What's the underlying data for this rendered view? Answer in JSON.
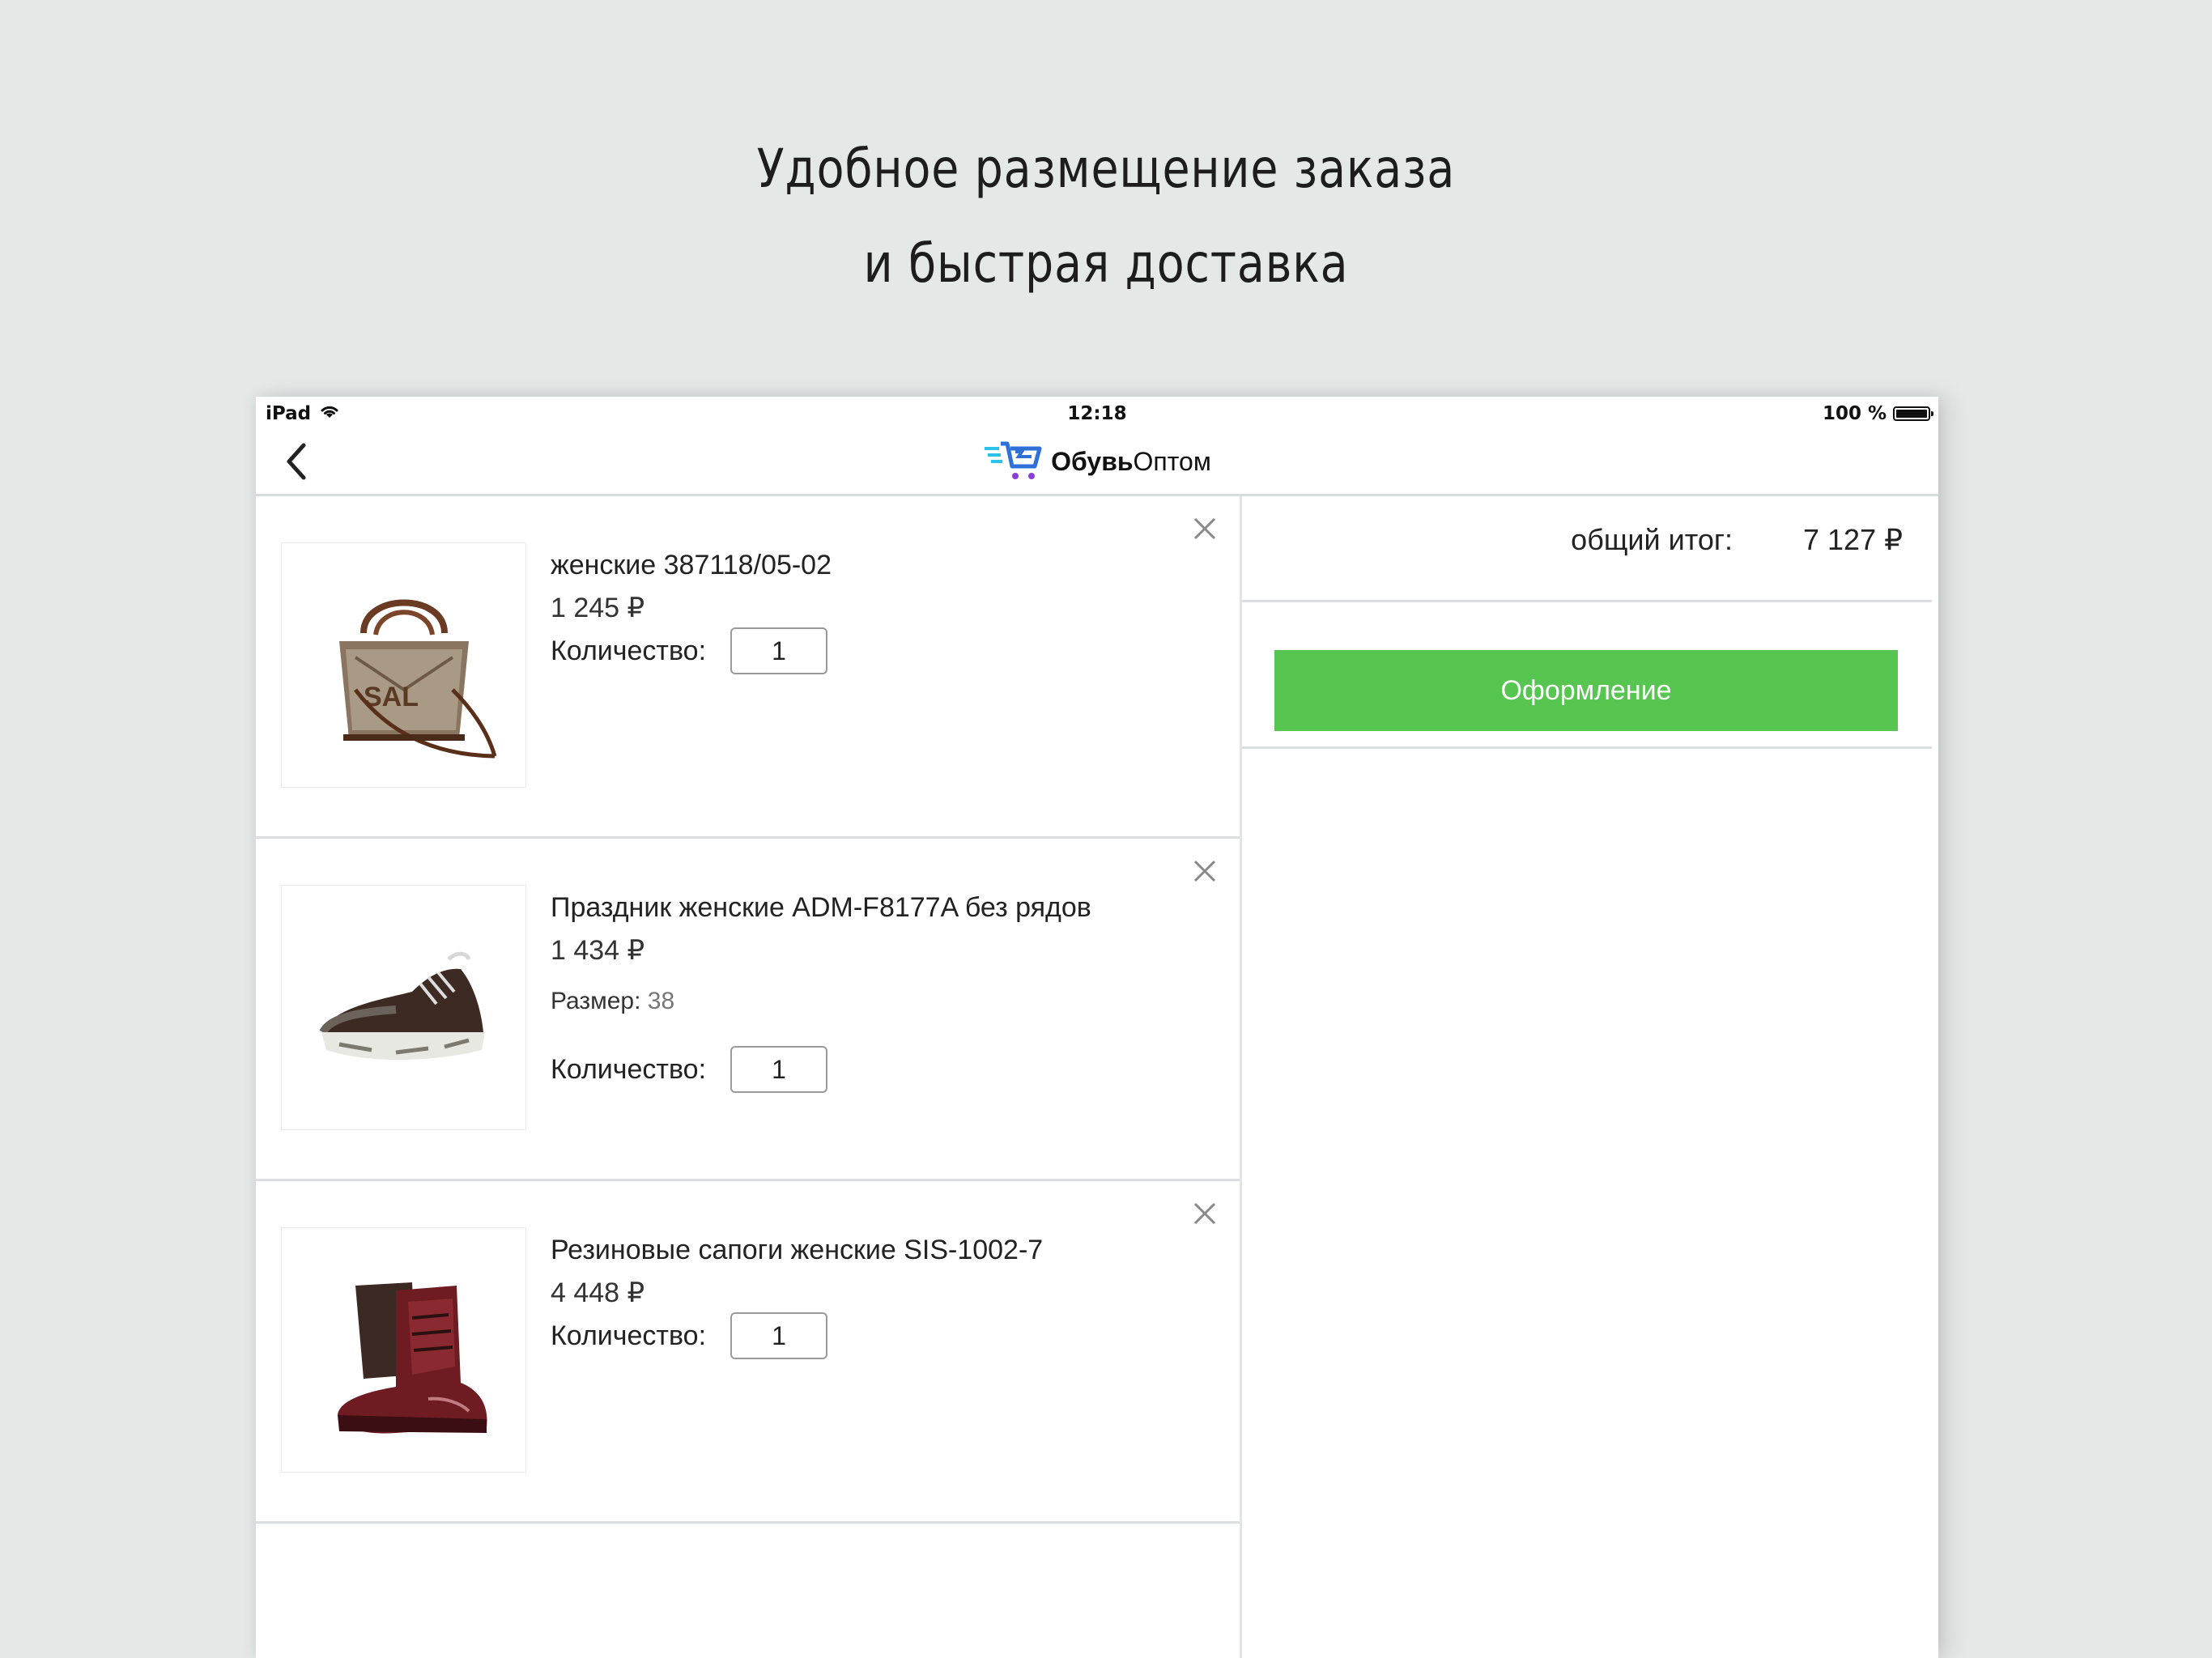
{
  "headline": {
    "line1": "Удобное размещение заказа",
    "line2": "и быстрая доставка"
  },
  "status_bar": {
    "device": "iPad",
    "time": "12:18",
    "battery": "100 %",
    "icons": [
      "wifi-icon",
      "battery-icon"
    ]
  },
  "nav": {
    "back_icon": "chevron-left-icon",
    "logo_icon": "cart-logo-icon",
    "logo_bold": "Обувь",
    "logo_regular": "Оптом",
    "logo_colors": {
      "blue": "#2f6fd8",
      "purple": "#8a3fd8",
      "cyan": "#2cc2e8"
    }
  },
  "cart": {
    "quantity_label": "Количество:",
    "items": [
      {
        "name": "женские 387118/05-02",
        "price": "1 245 ₽",
        "quantity": "1",
        "image": "handbag-image"
      },
      {
        "name": "Праздник женские ADM-F8177A без рядов",
        "price": "1 434 ₽",
        "size_label": "Размер:",
        "size_value": "38",
        "quantity": "1",
        "image": "sneaker-image"
      },
      {
        "name": "Резиновые сапоги женские SIS-1002-7",
        "price": "4 448 ₽",
        "quantity": "1",
        "image": "rubber-boot-image"
      }
    ]
  },
  "summary": {
    "total_label": "общий итог:",
    "total_value": "7 127 ₽",
    "checkout_label": "Оформление",
    "checkout_color": "#56c651"
  }
}
